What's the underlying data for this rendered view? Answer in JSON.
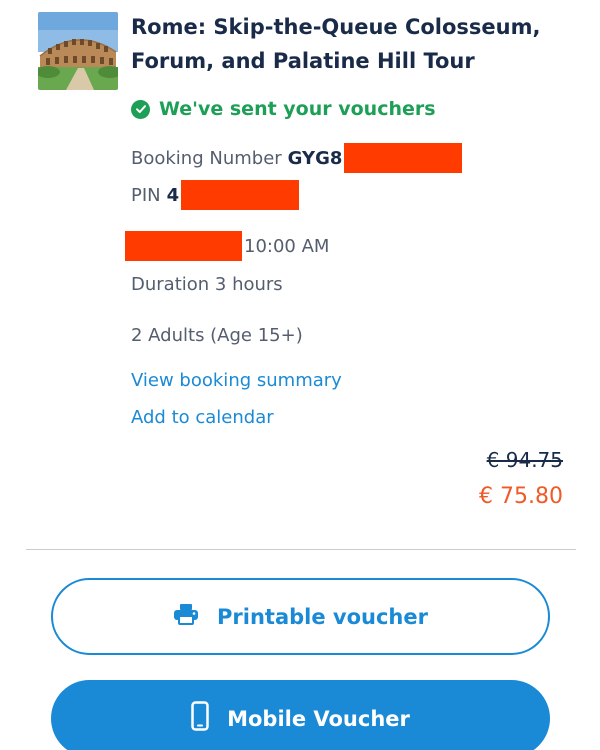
{
  "tour": {
    "title": "Rome: Skip-the-Queue Colosseum, Forum, and Palatine Hill Tour",
    "image_icon": "colosseum-photo"
  },
  "status": {
    "text": "We've sent your vouchers",
    "icon": "check-circle-icon",
    "color": "#1d9f57"
  },
  "booking": {
    "number_label": "Booking Number",
    "number_value": "GYG8",
    "pin_label": "PIN",
    "pin_value": "4",
    "time": "10:00 AM",
    "duration": "Duration 3 hours",
    "participants": "2 Adults (Age 15+)"
  },
  "links": {
    "summary": "View booking summary",
    "calendar": "Add to calendar"
  },
  "price": {
    "original": "€ 94.75",
    "discounted": "€ 75.80",
    "discount_color": "#ef5a27"
  },
  "actions": {
    "printable": "Printable voucher",
    "printable_icon": "printer-icon",
    "mobile": "Mobile Voucher",
    "mobile_icon": "mobile-phone-icon"
  },
  "colors": {
    "accent": "#1a8ad6",
    "text": "#1a2b49",
    "redaction": "#ff3b00"
  }
}
